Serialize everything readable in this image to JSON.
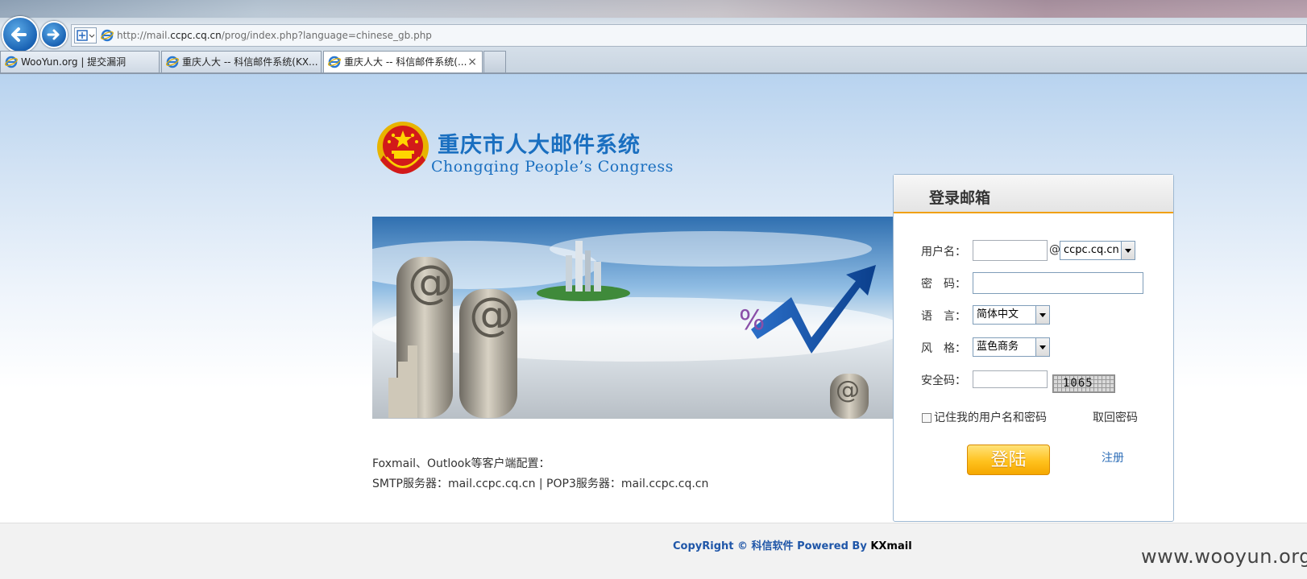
{
  "browser": {
    "url_prefix": "http://mail.",
    "url_host": "ccpc.cq.cn",
    "url_path": "/prog/index.php?language=chinese_gb.php",
    "tabs": [
      {
        "label": "WooYun.org | 提交漏洞",
        "active": false
      },
      {
        "label": "重庆人大 -- 科信邮件系统(KX...",
        "active": false
      },
      {
        "label": "重庆人大 -- 科信邮件系统(...",
        "active": true
      }
    ],
    "tab_close_glyph": "×"
  },
  "header": {
    "title_cn": "重庆市人大邮件系统",
    "title_en": "Chongqing People’s Congress"
  },
  "client_info": {
    "line1": "Foxmail、Outlook等客户端配置：",
    "line2": "SMTP服务器：mail.ccpc.cq.cn | POP3服务器：mail.ccpc.cq.cn"
  },
  "login": {
    "title": "登录邮箱",
    "username_label": "用户名：",
    "at_sign": "@",
    "domain_selected": "ccpc.cq.cn",
    "password_label": "密　码：",
    "language_label": "语　言：",
    "language_selected": "简体中文",
    "style_label": "风　格：",
    "style_selected": "蓝色商务",
    "captcha_label": "安全码：",
    "captcha_value": "1065",
    "remember_label": "记住我的用户名和密码",
    "forgot_link": "取回密码",
    "login_button": "登陆",
    "register_link": "注册"
  },
  "footer": {
    "copyright_prefix": "CopyRight © 科信软件 Powered By ",
    "copyright_brand": "KXmail",
    "watermark": "www.wooyun.org"
  },
  "colors": {
    "brand_blue": "#1a6fc0",
    "login_button": "#ffc21e",
    "link_blue": "#2f6fb8",
    "panel_accent": "#f0a010"
  },
  "icons": [
    "back-arrow-icon",
    "forward-arrow-icon",
    "compat-view-icon",
    "ie-logo-icon",
    "national-emblem-icon",
    "captcha-image"
  ]
}
